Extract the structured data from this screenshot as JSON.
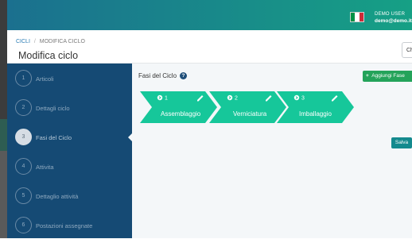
{
  "app": {
    "topbar_color": "#16a085",
    "sidebar_color": "#154a74",
    "accent_phase": "#16c79a"
  },
  "user": {
    "role": "DEMO USER",
    "email": "demo@demo.it",
    "flag_colors": [
      "#009246",
      "#ffffff",
      "#ce2b37"
    ]
  },
  "breadcrumb": {
    "items": [
      {
        "label": "CICLI"
      },
      {
        "label": "MODIFICA CICLO"
      }
    ],
    "separator": "/"
  },
  "page": {
    "title": "Modifica ciclo",
    "close_label": "Chiud"
  },
  "steps": [
    {
      "number": "1",
      "label": "Articoli",
      "active": false
    },
    {
      "number": "2",
      "label": "Dettagli ciclo",
      "active": false
    },
    {
      "number": "3",
      "label": "Fasi del Ciclo",
      "active": true
    },
    {
      "number": "4",
      "label": "Attivita",
      "active": false
    },
    {
      "number": "5",
      "label": "Dettaglio attività",
      "active": false
    },
    {
      "number": "6",
      "label": "Postazioni assegnate",
      "active": false
    }
  ],
  "main": {
    "title": "Fasi del Ciclo",
    "help_icon": "question-circle-icon",
    "add_button_label": "Aggiungi Fase",
    "save_label": "Salva"
  },
  "phases": [
    {
      "index": "1",
      "name": "Assemblaggio",
      "icon": "arrow-right-circle-icon",
      "edit_icon": "pencil-icon"
    },
    {
      "index": "2",
      "name": "Verniciatura",
      "icon": "arrow-right-circle-icon",
      "edit_icon": "pencil-icon"
    },
    {
      "index": "3",
      "name": "Imballaggio",
      "icon": "arrow-right-circle-icon",
      "edit_icon": "pencil-icon"
    }
  ]
}
